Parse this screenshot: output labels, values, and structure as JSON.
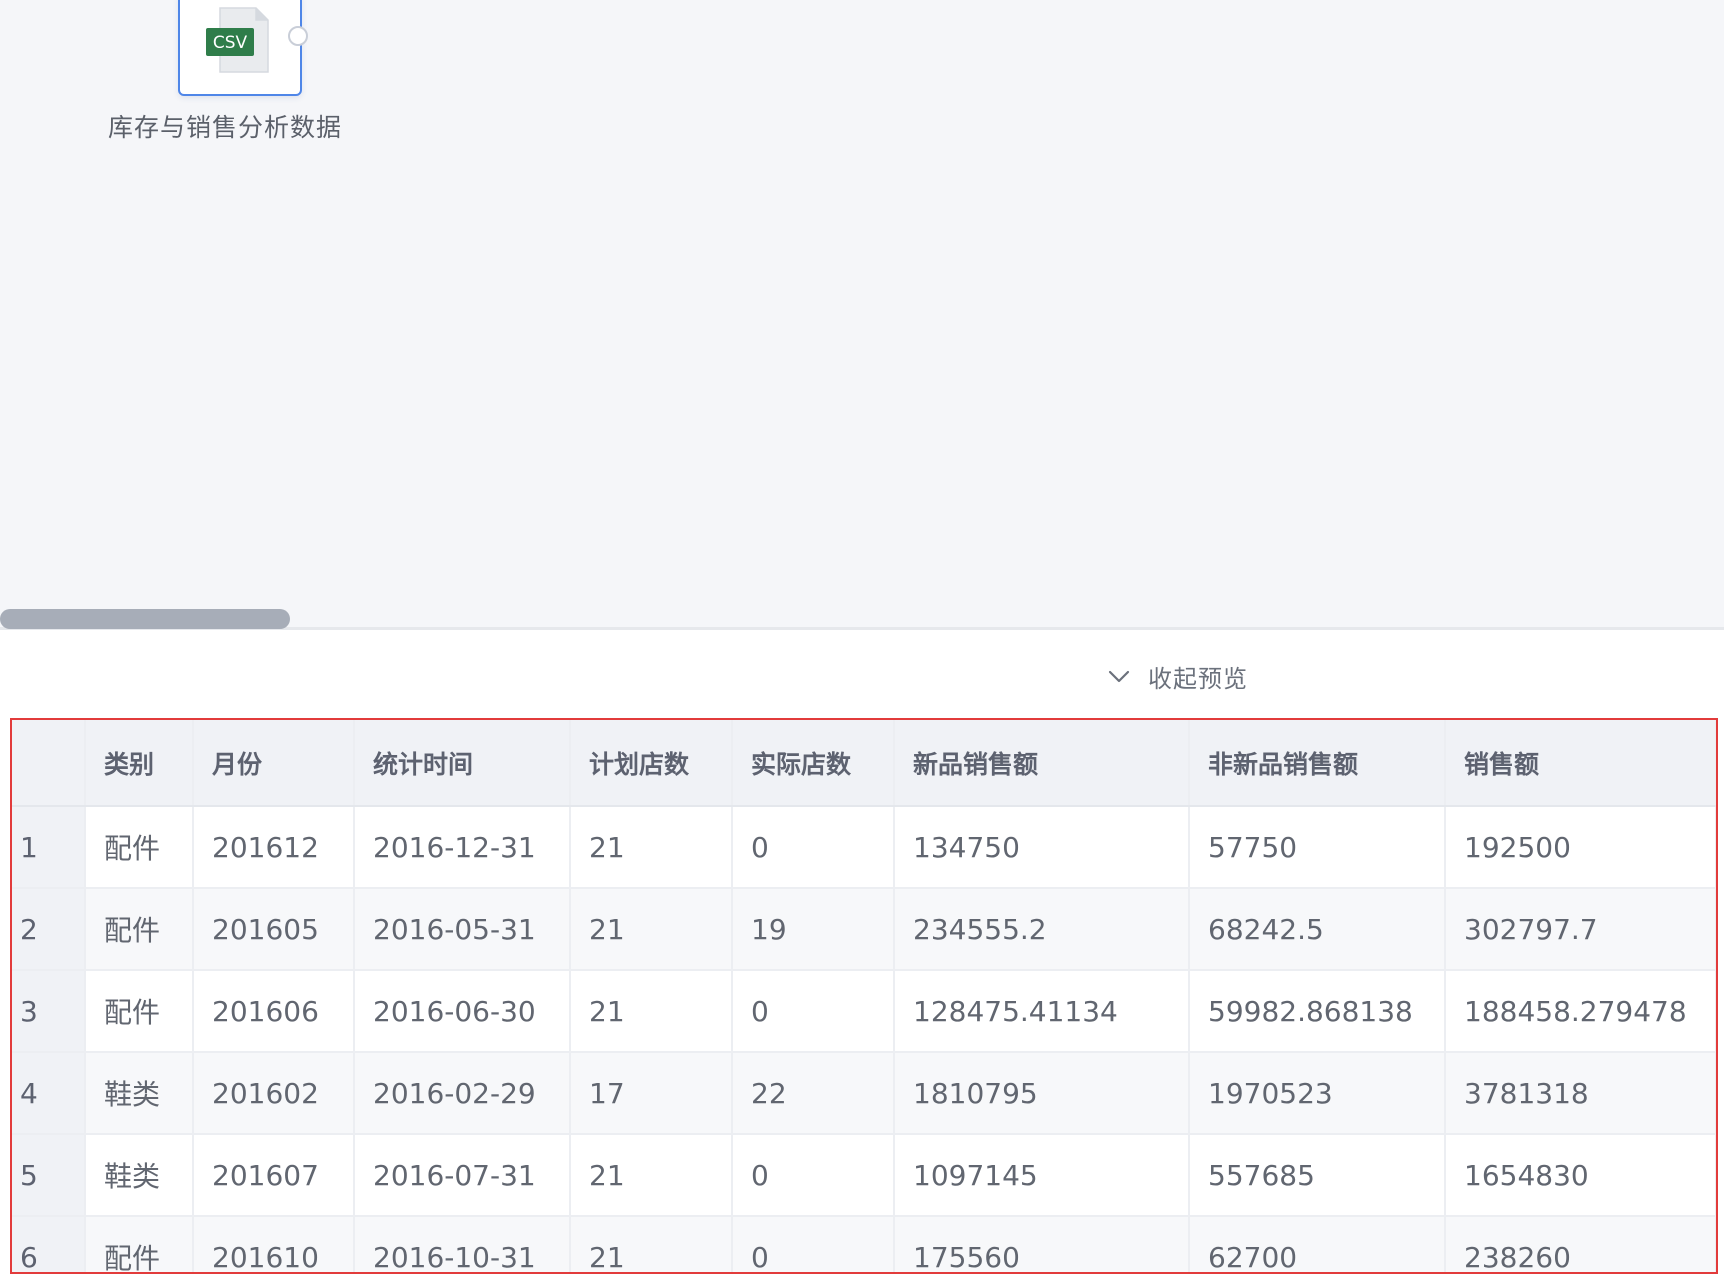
{
  "node": {
    "icon_text": "CSV",
    "label": "库存与销售分析数据"
  },
  "preview_toggle": {
    "label": "收起预览"
  },
  "table": {
    "columns": [
      "类别",
      "月份",
      "统计时间",
      "计划店数",
      "实际店数",
      "新品销售额",
      "非新品销售额",
      "销售额"
    ],
    "rows": [
      [
        "1",
        "配件",
        "201612",
        "2016-12-31",
        "21",
        "0",
        "134750",
        "57750",
        "192500"
      ],
      [
        "2",
        "配件",
        "201605",
        "2016-05-31",
        "21",
        "19",
        "234555.2",
        "68242.5",
        "302797.7"
      ],
      [
        "3",
        "配件",
        "201606",
        "2016-06-30",
        "21",
        "0",
        "128475.41134",
        "59982.868138",
        "188458.279478"
      ],
      [
        "4",
        "鞋类",
        "201602",
        "2016-02-29",
        "17",
        "22",
        "1810795",
        "1970523",
        "3781318"
      ],
      [
        "5",
        "鞋类",
        "201607",
        "2016-07-31",
        "21",
        "0",
        "1097145",
        "557685",
        "1654830"
      ],
      [
        "6",
        "配件",
        "201610",
        "2016-10-31",
        "21",
        "0",
        "175560",
        "62700",
        "238260"
      ]
    ]
  },
  "colors": {
    "accent": "#4f86e8",
    "csv_badge": "#2f7d4a",
    "highlight_frame": "#e23b3b"
  }
}
